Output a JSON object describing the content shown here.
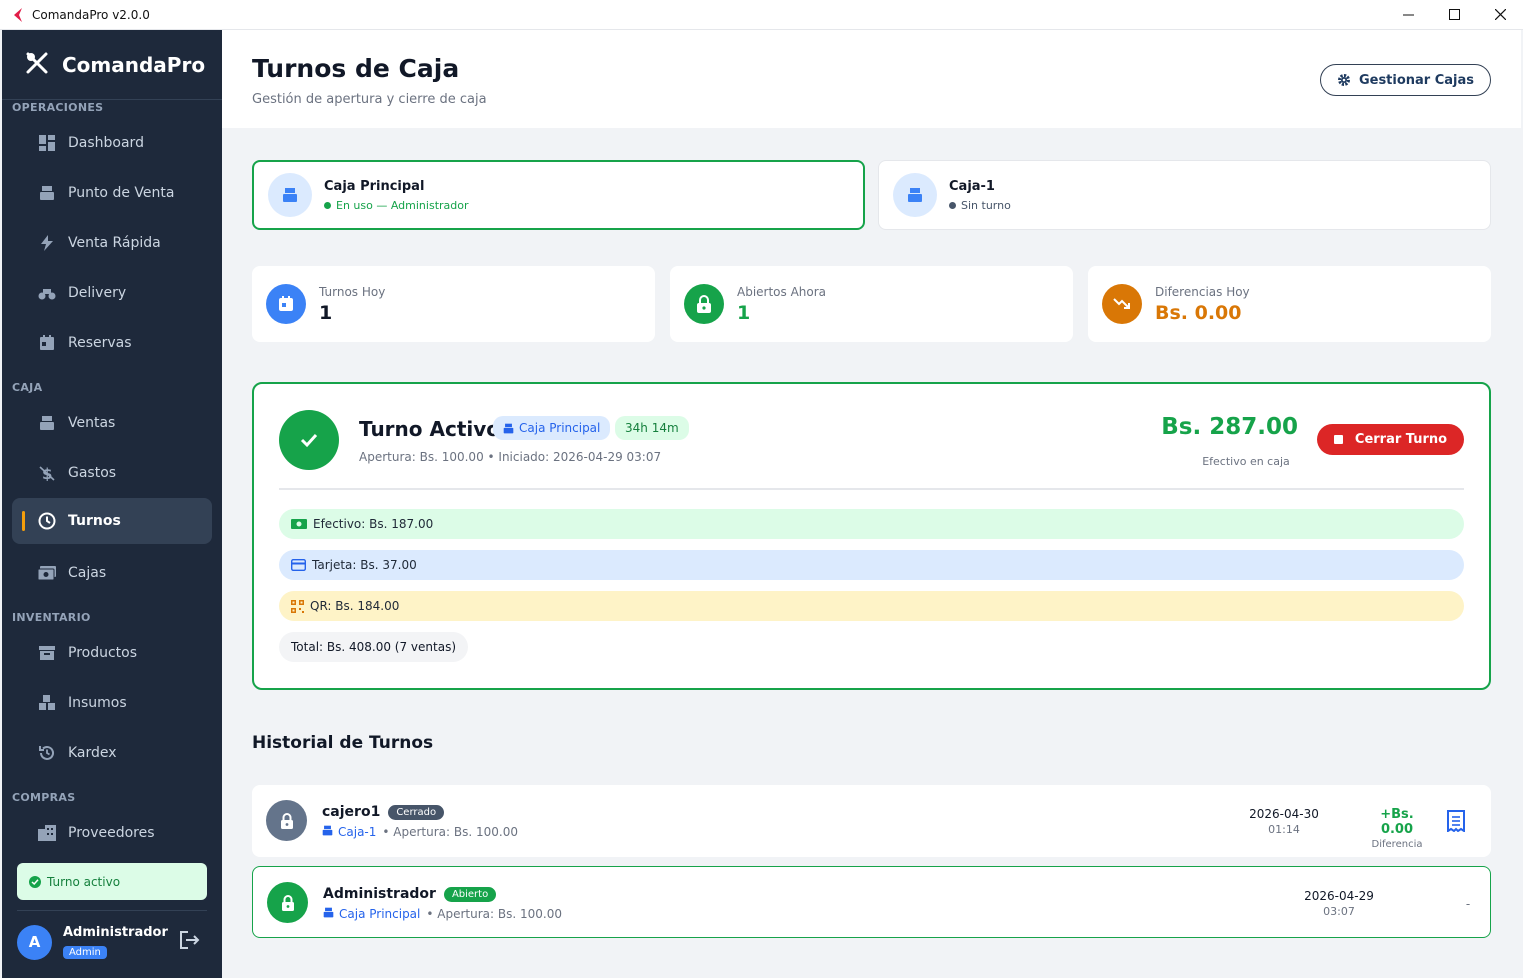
{
  "window": {
    "title": "ComandaPro v2.0.0"
  },
  "sidebar": {
    "brand": "ComandaPro",
    "sections": {
      "operaciones": "OPERACIONES",
      "caja": "CAJA",
      "inventario": "INVENTARIO",
      "compras": "COMPRAS"
    },
    "items": {
      "dashboard": "Dashboard",
      "punto_venta": "Punto de Venta",
      "venta_rapida": "Venta Rápida",
      "delivery": "Delivery",
      "reservas": "Reservas",
      "ventas": "Ventas",
      "gastos": "Gastos",
      "turnos": "Turnos",
      "cajas": "Cajas",
      "productos": "Productos",
      "insumos": "Insumos",
      "kardex": "Kardex",
      "proveedores": "Proveedores"
    },
    "turno_status": "Turno activo",
    "user": {
      "initial": "A",
      "name": "Administrador",
      "role": "Admin"
    }
  },
  "header": {
    "title": "Turnos de Caja",
    "subtitle": "Gestión de apertura y cierre de caja",
    "manage_button": "Gestionar Cajas"
  },
  "cajas": [
    {
      "name": "Caja Principal",
      "status": "En uso — Administrador",
      "status_color": "#16a34a"
    },
    {
      "name": "Caja-1",
      "status": "Sin turno",
      "status_color": "#475569"
    }
  ],
  "stats": [
    {
      "label": "Turnos Hoy",
      "value": "1",
      "color": "#3b82f6",
      "icon": "calendar-icon"
    },
    {
      "label": "Abiertos Ahora",
      "value": "1",
      "color": "#16a34a",
      "icon": "lock-open-icon"
    },
    {
      "label": "Diferencias Hoy",
      "value": "Bs. 0.00",
      "color": "#d97706",
      "icon": "trend-down-icon"
    }
  ],
  "active_shift": {
    "title": "Turno Activo",
    "caja_badge": "Caja Principal",
    "duration": "34h 14m",
    "subtitle": "Apertura: Bs. 100.00 • Iniciado: 2026-04-29 03:07",
    "cash_amount": "Bs. 287.00",
    "cash_label": "Efectivo en caja",
    "close_button": "Cerrar Turno",
    "payments": {
      "efectivo": "Efectivo: Bs. 187.00",
      "tarjeta": "Tarjeta: Bs. 37.00",
      "qr": "QR: Bs. 184.00"
    },
    "total": "Total: Bs. 408.00 (7 ventas)"
  },
  "history": {
    "title": "Historial de Turnos",
    "rows": [
      {
        "user": "cajero1",
        "status": "Cerrado",
        "caja": "Caja-1",
        "apertura": "• Apertura: Bs. 100.00",
        "date": "2026-04-30",
        "time": "01:14",
        "diff": "+Bs. 0.00",
        "diff_label": "Diferencia"
      },
      {
        "user": "Administrador",
        "status": "Abierto",
        "caja": "Caja Principal",
        "apertura": "• Apertura: Bs. 100.00",
        "date": "2026-04-29",
        "time": "03:07",
        "diff": "-"
      }
    ]
  },
  "colors": {
    "sidebar_bg": "#1e293b",
    "accent_green": "#16a34a",
    "accent_red": "#dc2626",
    "accent_blue": "#3b82f6",
    "accent_orange": "#d97706"
  }
}
